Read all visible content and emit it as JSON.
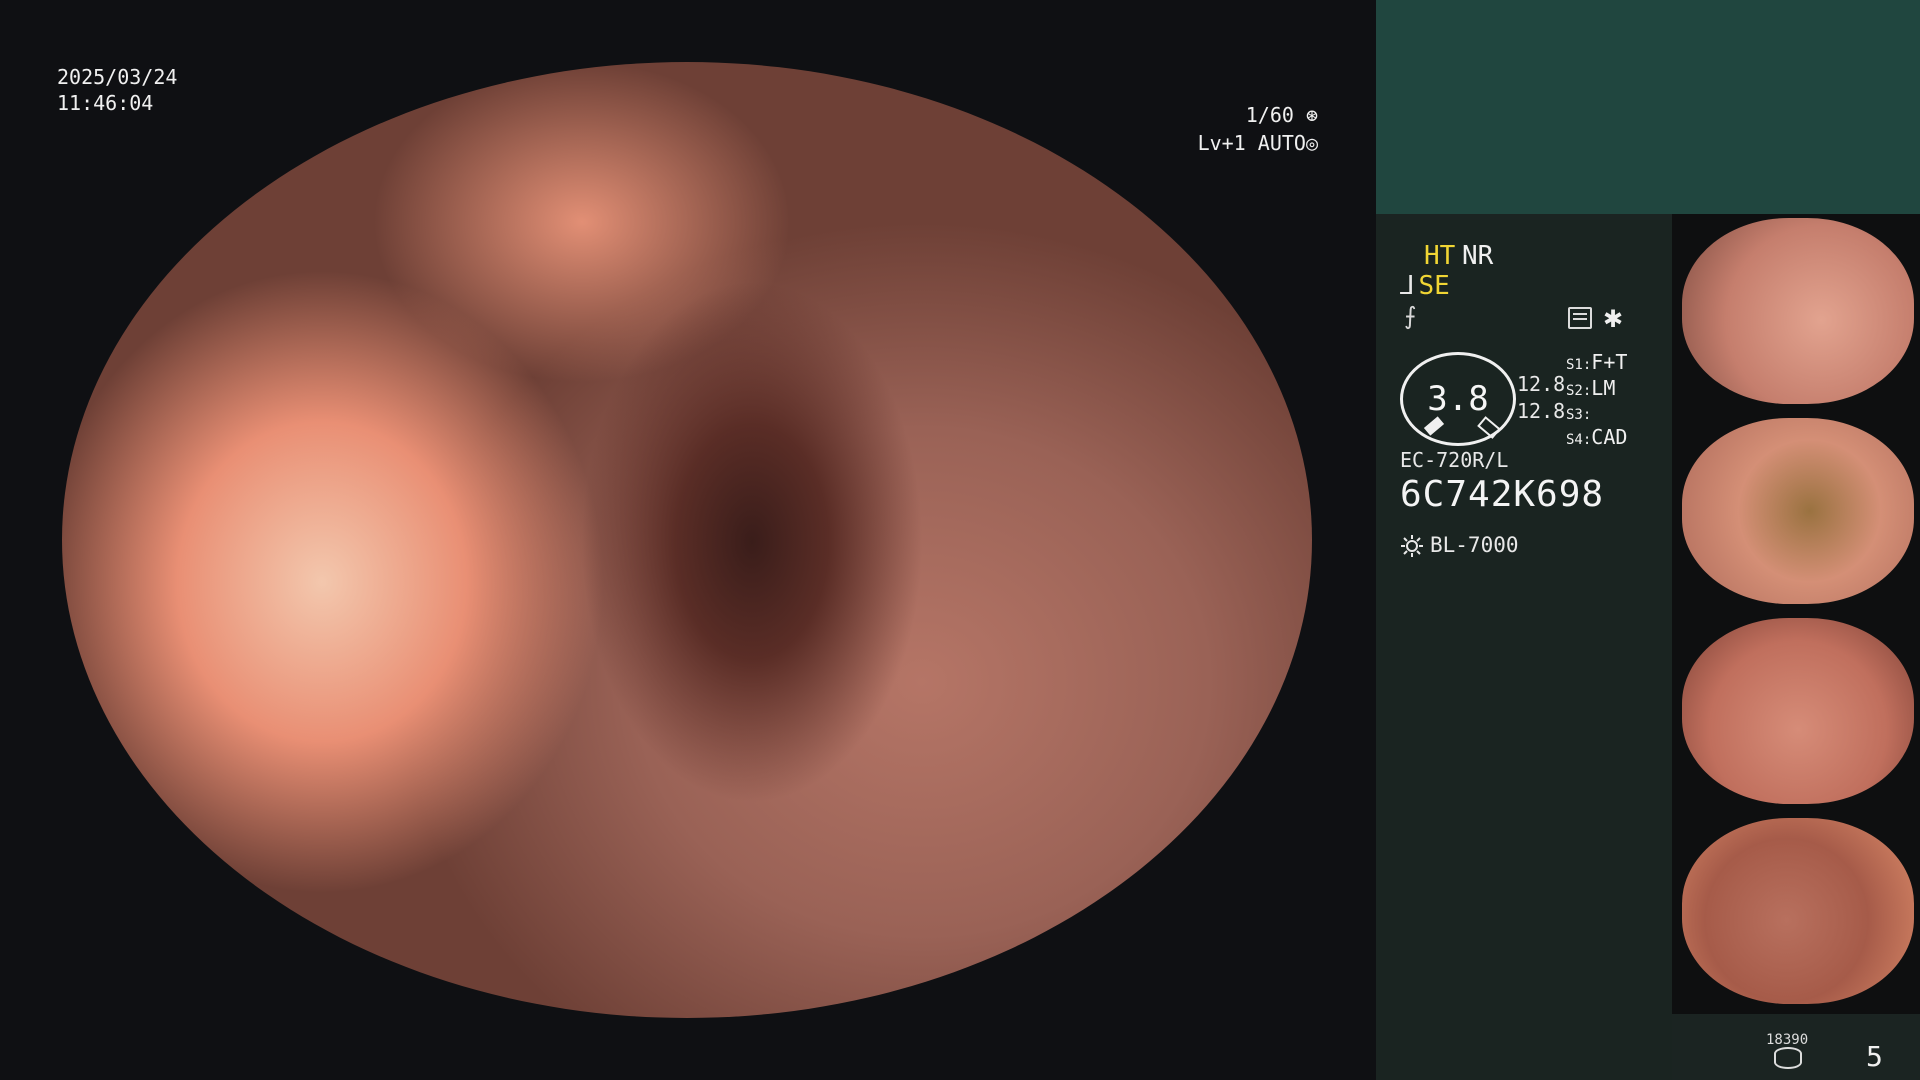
{
  "overlay": {
    "date": "2025/03/24",
    "time": "11:46:04",
    "shutter": "1/60",
    "level": "Lv+1",
    "mode": "AUTO"
  },
  "panel": {
    "ht": "HT",
    "nr": "NR",
    "se": "SE",
    "brightness": "3.8",
    "val1": "12.8",
    "val2": "12.8",
    "s1_label": "S1:",
    "s1_value": "F+T",
    "s2_label": "S2:",
    "s2_value": "LM",
    "s3_label": "S3:",
    "s3_value": "",
    "s4_label": "S4:",
    "s4_value": "CAD",
    "model": "EC-720R/L",
    "serial": "6C742K698",
    "light_source": "BL-7000",
    "counter": "18390",
    "page": "5"
  },
  "icons": {
    "shutter_icon": "aperture-icon",
    "mode_icon": "auto-iris-icon",
    "settings_icon": "grid-settings-icon",
    "star_icon": "asterisk-icon",
    "light_icon": "sun-icon",
    "db_icon": "database-icon"
  }
}
